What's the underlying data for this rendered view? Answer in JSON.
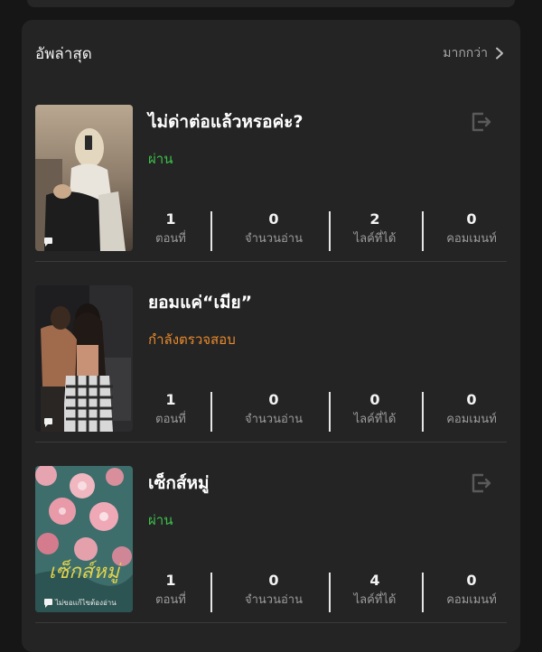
{
  "section": {
    "title": "อัพล่าสุด",
    "more_label": "มากกว่า"
  },
  "stat_labels": {
    "episodes": "ตอนที่",
    "reads": "จำนวนอ่าน",
    "likes": "ไลค์ที่ได้",
    "comments": "คอมเมนท์"
  },
  "stories": [
    {
      "title": "ไม่ด่าต่อแล้วหรอค่ะ?",
      "status": "ผ่าน",
      "status_color": "#3cc24a",
      "episodes": "1",
      "reads": "0",
      "likes": "2",
      "comments": "0"
    },
    {
      "title": "ยอมแค่“เมีย”",
      "status": "กำลังตรวจสอบ",
      "status_color": "#e8892c",
      "episodes": "1",
      "reads": "0",
      "likes": "0",
      "comments": "0"
    },
    {
      "title": "เซ็กส์หมู่",
      "status": "ผ่าน",
      "status_color": "#3cc24a",
      "cover_caption": "ไม่ขอแก้ไขต้องอ่าน",
      "episodes": "1",
      "reads": "0",
      "likes": "4",
      "comments": "0"
    }
  ]
}
